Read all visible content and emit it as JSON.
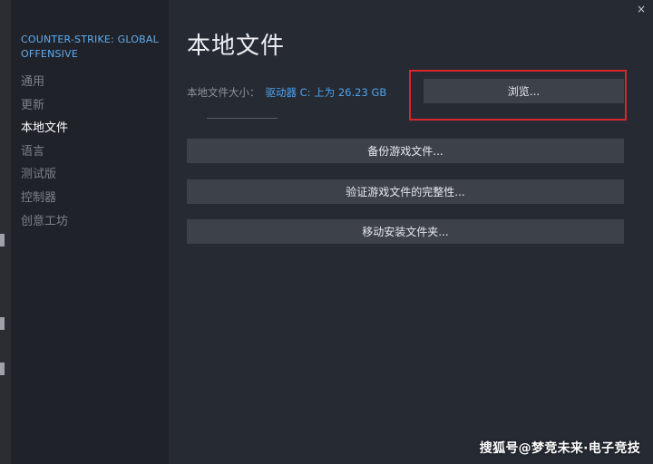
{
  "sidebar": {
    "game_title": "COUNTER-STRIKE: GLOBAL OFFENSIVE",
    "items": [
      {
        "label": "通用"
      },
      {
        "label": "更新"
      },
      {
        "label": "本地文件"
      },
      {
        "label": "语言"
      },
      {
        "label": "测试版"
      },
      {
        "label": "控制器"
      },
      {
        "label": "创意工坊"
      }
    ],
    "active_item": "本地文件"
  },
  "main": {
    "title": "本地文件",
    "size_label": "本地文件大小：",
    "size_value": "驱动器 C: 上为 26.23 GB",
    "browse_button": "浏览...",
    "buttons": [
      {
        "label": "备份游戏文件..."
      },
      {
        "label": "验证游戏文件的完整性..."
      },
      {
        "label": "移动安装文件夹..."
      }
    ]
  },
  "window": {
    "close_glyph": "×"
  },
  "watermark": "搜狐号@梦竞未来·电子竞技",
  "colors": {
    "accent_link": "#4ea3ee",
    "highlight_border": "#d9262c",
    "sidebar_bg": "#20222a",
    "main_bg": "#262a33",
    "button_bg": "#3d414a"
  }
}
